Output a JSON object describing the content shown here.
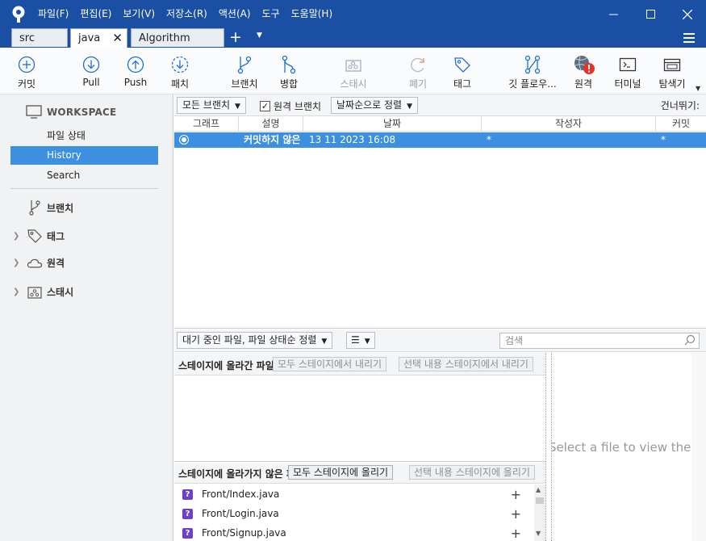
{
  "menu": {
    "items": [
      "파일(F)",
      "편집(E)",
      "보기(V)",
      "저장소(R)",
      "액션(A)",
      "도구",
      "도움말(H)"
    ]
  },
  "tabs": [
    {
      "label": "src"
    },
    {
      "label": "java"
    },
    {
      "label": "Algorithm"
    }
  ],
  "toolbar": {
    "commit": "커밋",
    "pull": "Pull",
    "push": "Push",
    "fetch": "패치",
    "branch": "브랜치",
    "merge": "병합",
    "stash": "스태시",
    "discard": "폐기",
    "tag": "태그",
    "gitflow": "깃 플로우...",
    "remote": "원격",
    "terminal": "터미널",
    "explorer": "탐색기"
  },
  "sidebar": {
    "workspace": "WORKSPACE",
    "file_status": "파일 상태",
    "history": "History",
    "search": "Search",
    "branches": "브랜치",
    "tags": "태그",
    "remotes": "원격",
    "stashes": "스태시"
  },
  "filters": {
    "all_branches": "모든 브랜치",
    "remote_branches": "원격 브랜치",
    "sort": "날짜순으로 정렬",
    "jump_to": "건너뛰기:"
  },
  "columns": {
    "graph": "그래프",
    "description": "설명",
    "date": "날짜",
    "author": "작성자",
    "commit": "커밋"
  },
  "history_rows": [
    {
      "description": "커밋하지 않은",
      "date": "13 11 2023 16:08",
      "author": "*",
      "commit": "*"
    }
  ],
  "lower": {
    "pending_sort": "대기 중인 파일, 파일 상태순 정렬",
    "search_placeholder": "검색",
    "staged_title": "스테이지에 올라간 파일",
    "unstage_all": "모두 스테이지에서 내리기",
    "unstage_selected": "선택 내용 스테이지에서 내리기",
    "unstaged_title": "스테이지에 올라가지 않은 파일",
    "stage_all": "모두 스테이지에 올리기",
    "stage_selected": "선택 내용 스테이지에 올리기",
    "diff_message": "Select a file to view the diff"
  },
  "unstaged_files": [
    {
      "name": "Front/Index.java"
    },
    {
      "name": "Front/Login.java"
    },
    {
      "name": "Front/Signup.java"
    }
  ],
  "colors": {
    "titlebar": "#1a4fa4",
    "selection": "#3d8fe0",
    "unknown_badge": "#6e3fc7",
    "icon_blue": "#1f6fd1",
    "alert_red": "#e8312a"
  }
}
